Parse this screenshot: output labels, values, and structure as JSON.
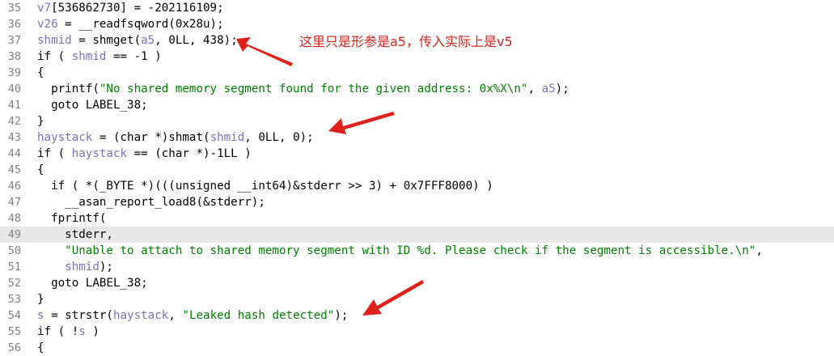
{
  "editor": {
    "highlighted_line": 49,
    "lines": [
      {
        "num": "35",
        "tokens": [
          {
            "t": "v7",
            "c": "var"
          },
          {
            "t": "[536862730] = -202116109;",
            "c": ""
          }
        ]
      },
      {
        "num": "36",
        "tokens": [
          {
            "t": "v26",
            "c": "var"
          },
          {
            "t": " = __readfsqword(0x28u);",
            "c": ""
          }
        ]
      },
      {
        "num": "37",
        "tokens": [
          {
            "t": "shmid",
            "c": "var"
          },
          {
            "t": " = shmget(",
            "c": ""
          },
          {
            "t": "a5",
            "c": "var"
          },
          {
            "t": ", 0LL, 438);",
            "c": ""
          }
        ]
      },
      {
        "num": "38",
        "tokens": [
          {
            "t": "if ( ",
            "c": ""
          },
          {
            "t": "shmid",
            "c": "var"
          },
          {
            "t": " == -1 )",
            "c": ""
          }
        ]
      },
      {
        "num": "39",
        "tokens": [
          {
            "t": "{",
            "c": ""
          }
        ]
      },
      {
        "num": "40",
        "tokens": [
          {
            "t": "  printf(",
            "c": ""
          },
          {
            "t": "\"No shared memory segment found for the given address: 0x%X\\n\"",
            "c": "str"
          },
          {
            "t": ", ",
            "c": ""
          },
          {
            "t": "a5",
            "c": "var"
          },
          {
            "t": ");",
            "c": ""
          }
        ]
      },
      {
        "num": "41",
        "tokens": [
          {
            "t": "  goto LABEL_38;",
            "c": ""
          }
        ]
      },
      {
        "num": "42",
        "tokens": [
          {
            "t": "}",
            "c": ""
          }
        ]
      },
      {
        "num": "43",
        "tokens": [
          {
            "t": "haystack",
            "c": "var"
          },
          {
            "t": " = (char *)shmat(",
            "c": ""
          },
          {
            "t": "shmid",
            "c": "var"
          },
          {
            "t": ", 0LL, 0);",
            "c": ""
          }
        ]
      },
      {
        "num": "44",
        "tokens": [
          {
            "t": "if ( ",
            "c": ""
          },
          {
            "t": "haystack",
            "c": "var"
          },
          {
            "t": " == (char *)-1LL )",
            "c": ""
          }
        ]
      },
      {
        "num": "45",
        "tokens": [
          {
            "t": "{",
            "c": ""
          }
        ]
      },
      {
        "num": "46",
        "tokens": [
          {
            "t": "  if ( *(_BYTE *)(((unsigned __int64)&stderr >> 3) + 0x7FFF8000) )",
            "c": ""
          }
        ]
      },
      {
        "num": "47",
        "tokens": [
          {
            "t": "    __asan_report_load8(&stderr);",
            "c": ""
          }
        ]
      },
      {
        "num": "48",
        "tokens": [
          {
            "t": "  fprintf(",
            "c": ""
          }
        ]
      },
      {
        "num": "49",
        "tokens": [
          {
            "t": "    stderr,",
            "c": ""
          }
        ]
      },
      {
        "num": "50",
        "tokens": [
          {
            "t": "    ",
            "c": ""
          },
          {
            "t": "\"Unable to attach to shared memory segment with ID %d. Please check if the segment is accessible.\\n\"",
            "c": "str"
          },
          {
            "t": ",",
            "c": ""
          }
        ]
      },
      {
        "num": "51",
        "tokens": [
          {
            "t": "    ",
            "c": ""
          },
          {
            "t": "shmid",
            "c": "var"
          },
          {
            "t": ");",
            "c": ""
          }
        ]
      },
      {
        "num": "52",
        "tokens": [
          {
            "t": "  goto LABEL_38;",
            "c": ""
          }
        ]
      },
      {
        "num": "53",
        "tokens": [
          {
            "t": "}",
            "c": ""
          }
        ]
      },
      {
        "num": "54",
        "tokens": [
          {
            "t": "s",
            "c": "var"
          },
          {
            "t": " = strstr(",
            "c": ""
          },
          {
            "t": "haystack",
            "c": "var"
          },
          {
            "t": ", ",
            "c": ""
          },
          {
            "t": "\"Leaked hash detected\"",
            "c": "str"
          },
          {
            "t": ");",
            "c": ""
          }
        ]
      },
      {
        "num": "55",
        "tokens": [
          {
            "t": "if ( !",
            "c": ""
          },
          {
            "t": "s",
            "c": "var"
          },
          {
            "t": " )",
            "c": ""
          }
        ]
      },
      {
        "num": "56",
        "tokens": [
          {
            "t": "{",
            "c": ""
          }
        ]
      }
    ]
  },
  "annotation": {
    "note": "这里只是形参是a5，传入实际上是v5",
    "arrow_color": "#e0201a"
  }
}
